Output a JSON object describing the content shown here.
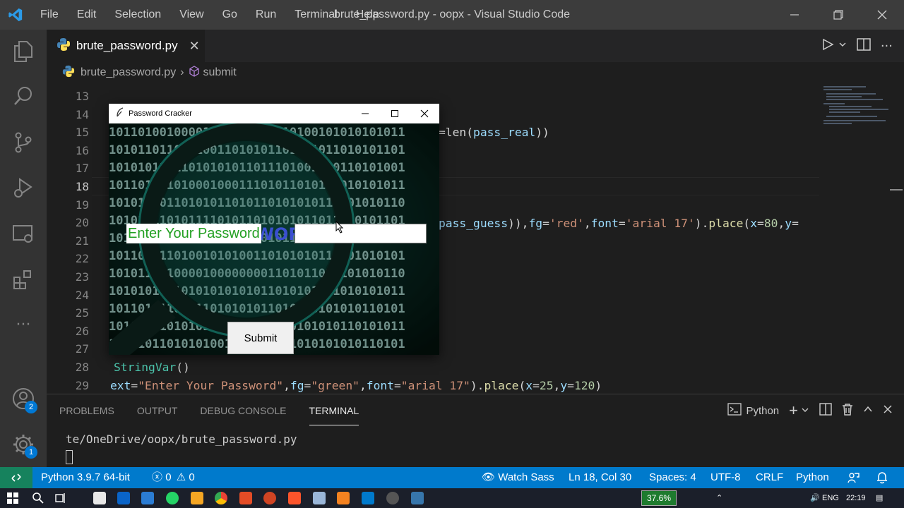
{
  "titlebar": {
    "menu": [
      "File",
      "Edit",
      "Selection",
      "View",
      "Go",
      "Run",
      "Terminal",
      "Help"
    ],
    "title": "brute_password.py - oopx - Visual Studio Code"
  },
  "activitybar": {
    "accounts_badge": "2",
    "manage_badge": "1"
  },
  "tab": {
    "label": "brute_password.py"
  },
  "breadcrumb": {
    "file": "brute_password.py",
    "symbol": "submit"
  },
  "editor": {
    "line_numbers": [
      "13",
      "14",
      "15",
      "16",
      "17",
      "18",
      "19",
      "20",
      "21",
      "22",
      "23",
      "24",
      "25",
      "26",
      "27",
      "28",
      "29"
    ],
    "active_line": "18",
    "snippets": {
      "line15_a": "=len(",
      "line15_b": "pass_real",
      "line15_c": "))",
      "line20_a": "pass_guess",
      "line20_b": ")),",
      "line20_c": "fg",
      "line20_d": "=",
      "line20_e": "'red'",
      "line20_f": ",",
      "line20_g": "font",
      "line20_h": "=",
      "line20_i": "'arial 17'",
      "line20_j": ").",
      "line20_k": "place",
      "line20_l": "(",
      "line20_m": "x",
      "line20_n": "=",
      "line20_o": "80",
      "line20_p": ",",
      "line20_q": "y",
      "line20_r": "=",
      "line28_a": "StringVar",
      "line28_b": "()",
      "line29_a": "ext",
      "line29_b": "=",
      "line29_c": "\"Enter Your Password\"",
      "line29_d": ",",
      "line29_e": "fg",
      "line29_f": "=",
      "line29_g": "\"green\"",
      "line29_h": ",",
      "line29_i": "font",
      "line29_j": "=",
      "line29_k": "\"arial 17\"",
      "line29_l": ").",
      "line29_m": "place",
      "line29_n": "(",
      "line29_o": "x",
      "line29_p": "=",
      "line29_q": "25",
      "line29_r": ",",
      "line29_s": "y",
      "line29_t": "=",
      "line29_u": "120",
      "line29_v": ")"
    }
  },
  "panel": {
    "tabs": [
      "PROBLEMS",
      "OUTPUT",
      "DEBUG CONSOLE",
      "TERMINAL"
    ],
    "active_tab": "TERMINAL",
    "terminal_name": "Python",
    "terminal_line": "te/OneDrive/oopx/brute_password.py"
  },
  "statusbar": {
    "interpreter": "Python 3.9.7 64-bit",
    "errors": "0",
    "warnings": "0",
    "watch_sass": "Watch Sass",
    "position": "Ln 18, Col 30",
    "spaces": "Spaces: 4",
    "encoding": "UTF-8",
    "eol": "CRLF",
    "language": "Python"
  },
  "tk_app": {
    "title": "Password Cracker",
    "label": "Enter Your Password",
    "entry_value": "",
    "button": "Submit",
    "background_word": "PASSWORD"
  },
  "taskbar": {
    "battery": "37.6%",
    "language": "ENG",
    "time": "22:19"
  },
  "colors": {
    "accent": "#007acc",
    "remote": "#16825d",
    "label_green": "#22a022"
  }
}
